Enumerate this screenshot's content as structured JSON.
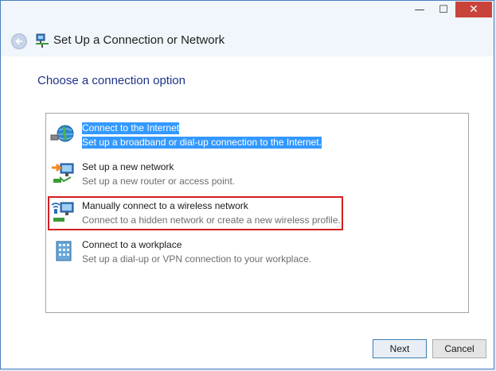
{
  "window": {
    "minimize": "—",
    "maximize": "☐",
    "close": "✕"
  },
  "wizard": {
    "title": "Set Up a Connection or Network",
    "heading": "Choose a connection option"
  },
  "options": [
    {
      "title": "Connect to the Internet",
      "description": "Set up a broadband or dial-up connection to the Internet.",
      "icon": "globe-network-icon",
      "selected": true
    },
    {
      "title": "Set up a new network",
      "description": "Set up a new router or access point.",
      "icon": "new-network-icon",
      "selected": false
    },
    {
      "title": "Manually connect to a wireless network",
      "description": "Connect to a hidden network or create a new wireless profile.",
      "icon": "wireless-network-icon",
      "selected": false
    },
    {
      "title": "Connect to a workplace",
      "description": "Set up a dial-up or VPN connection to your workplace.",
      "icon": "workplace-icon",
      "selected": false
    }
  ],
  "buttons": {
    "next": "Next",
    "cancel": "Cancel"
  },
  "colors": {
    "selection": "#3399ff",
    "heading": "#1e3287",
    "highlight_border": "#d21f24",
    "close_button": "#c8443a"
  }
}
